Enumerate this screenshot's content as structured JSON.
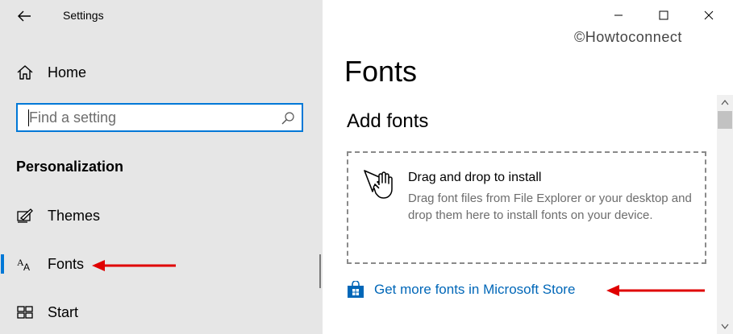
{
  "sidebar": {
    "app_title": "Settings",
    "home_label": "Home",
    "search_placeholder": "Find a setting",
    "section_heading": "Personalization",
    "items": [
      {
        "label": "Themes",
        "icon": "themes-icon",
        "selected": false
      },
      {
        "label": "Fonts",
        "icon": "fonts-icon",
        "selected": true
      },
      {
        "label": "Start",
        "icon": "start-icon",
        "selected": false
      }
    ]
  },
  "content": {
    "watermark": "©Howtoconnect",
    "page_title": "Fonts",
    "section_title": "Add fonts",
    "drop_zone": {
      "title": "Drag and drop to install",
      "description": "Drag font files from File Explorer or your desktop and drop them here to install fonts on your device."
    },
    "store_link": "Get more fonts in Microsoft Store"
  },
  "colors": {
    "accent": "#0078d7",
    "link": "#0067b8",
    "annotation_arrow": "#e00000",
    "sidebar_bg": "#e6e6e6"
  }
}
